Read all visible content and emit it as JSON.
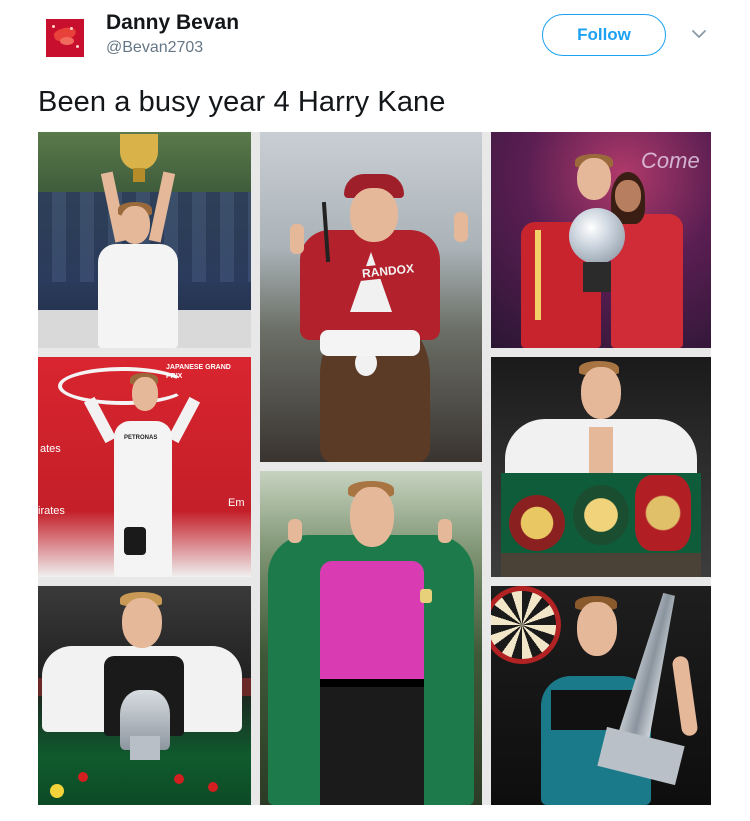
{
  "tweet": {
    "display_name": "Danny Bevan",
    "handle": "@Bevan2703",
    "follow_label": "Follow",
    "text": "Been a busy year 4 Harry Kane"
  },
  "collage": {
    "jockey_sponsor": "RANDOX",
    "f1_banner": "JAPANESE GRAND PRIX",
    "f1_suit_brand": "PETRONAS",
    "f1_side_text_1": "ates",
    "f1_side_text_2": "irates",
    "f1_side_text_3": "Em",
    "dance_logo": "Come"
  },
  "colors": {
    "accent": "#1da1f2",
    "name": "#14171a",
    "secondary": "#657786"
  },
  "icons": {
    "more": "chevron-down-icon"
  }
}
